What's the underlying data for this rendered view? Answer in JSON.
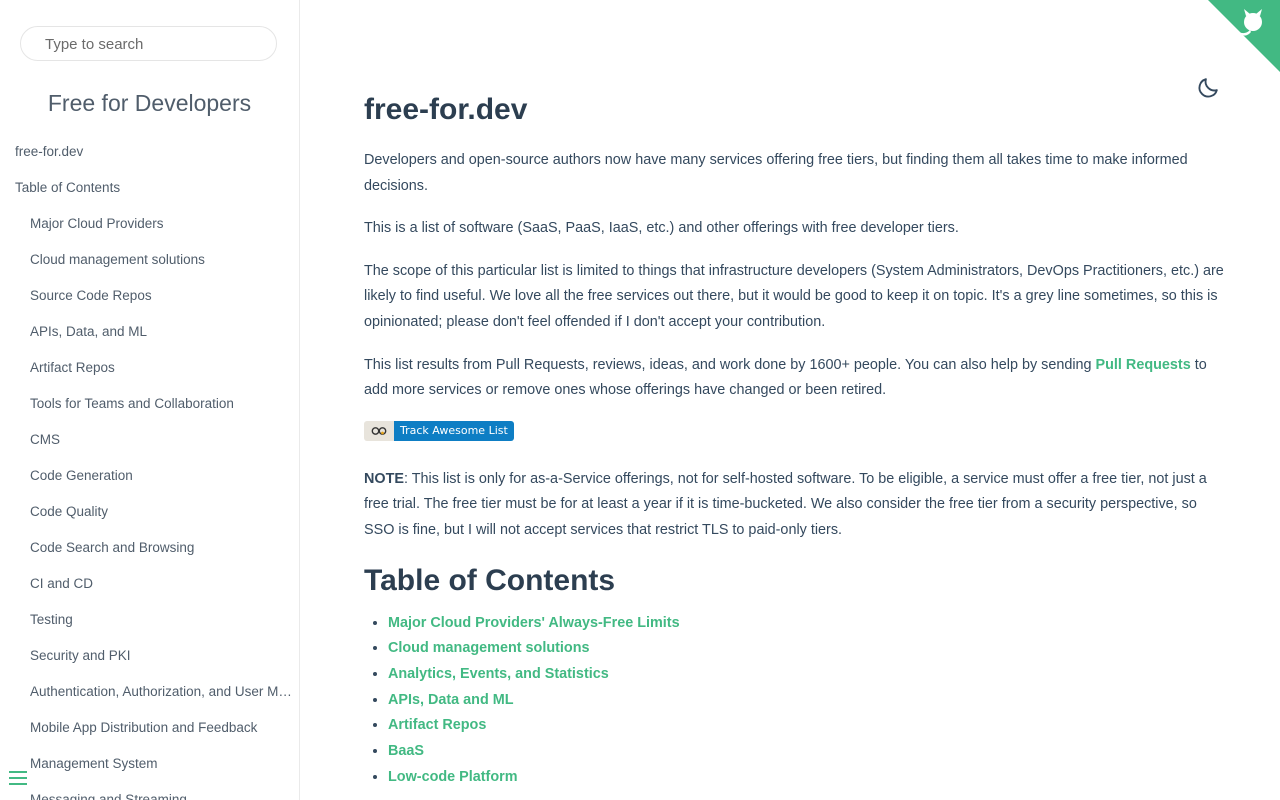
{
  "sidebar": {
    "search_placeholder": "Type to search",
    "app_name": "Free for Developers",
    "items": [
      {
        "label": "free-for.dev",
        "level": 1
      },
      {
        "label": "Table of Contents",
        "level": 1
      },
      {
        "label": "Major Cloud Providers",
        "level": 2
      },
      {
        "label": "Cloud management solutions",
        "level": 2
      },
      {
        "label": "Source Code Repos",
        "level": 2
      },
      {
        "label": "APIs, Data, and ML",
        "level": 2
      },
      {
        "label": "Artifact Repos",
        "level": 2
      },
      {
        "label": "Tools for Teams and Collaboration",
        "level": 2
      },
      {
        "label": "CMS",
        "level": 2
      },
      {
        "label": "Code Generation",
        "level": 2
      },
      {
        "label": "Code Quality",
        "level": 2
      },
      {
        "label": "Code Search and Browsing",
        "level": 2
      },
      {
        "label": "CI and CD",
        "level": 2
      },
      {
        "label": "Testing",
        "level": 2
      },
      {
        "label": "Security and PKI",
        "level": 2
      },
      {
        "label": "Authentication, Authorization, and User Management",
        "level": 2
      },
      {
        "label": "Mobile App Distribution and Feedback",
        "level": 2
      },
      {
        "label": "Management System",
        "level": 2
      },
      {
        "label": "Messaging and Streaming",
        "level": 2
      }
    ]
  },
  "icons": {
    "corner": "github-octocat-icon",
    "theme": "moon-icon",
    "menu": "hamburger-menu-icon",
    "badge": "awesome-glasses-icon"
  },
  "colors": {
    "accent": "#42b983",
    "text": "#34495e",
    "badge_blue": "#0e7ec4"
  },
  "main": {
    "title": "free-for.dev",
    "p1": "Developers and open-source authors now have many services offering free tiers, but finding them all takes time to make informed decisions.",
    "p2": "This is a list of software (SaaS, PaaS, IaaS, etc.) and other offerings with free developer tiers.",
    "p3": "The scope of this particular list is limited to things that infrastructure developers (System Administrators, DevOps Practitioners, etc.) are likely to find useful. We love all the free services out there, but it would be good to keep it on topic. It's a grey line sometimes, so this is opinionated; please don't feel offended if I don't accept your contribution.",
    "p4_before": "This list results from Pull Requests, reviews, ideas, and work done by 1600+ people. You can also help by sending ",
    "p4_link": "Pull Requests",
    "p4_after": " to add more services or remove ones whose offerings have changed or been retired.",
    "badge_label": "Track Awesome List",
    "note_label": "NOTE",
    "note_text": ": This list is only for as-a-Service offerings, not for self-hosted software. To be eligible, a service must offer a free tier, not just a free trial. The free tier must be for at least a year if it is time-bucketed. We also consider the free tier from a security perspective, so SSO is fine, but I will not accept services that restrict TLS to paid-only tiers.",
    "toc_heading": "Table of Contents",
    "toc_items": [
      "Major Cloud Providers' Always-Free Limits",
      "Cloud management solutions",
      "Analytics, Events, and Statistics",
      "APIs, Data and ML",
      "Artifact Repos",
      "BaaS",
      "Low-code Platform"
    ]
  }
}
